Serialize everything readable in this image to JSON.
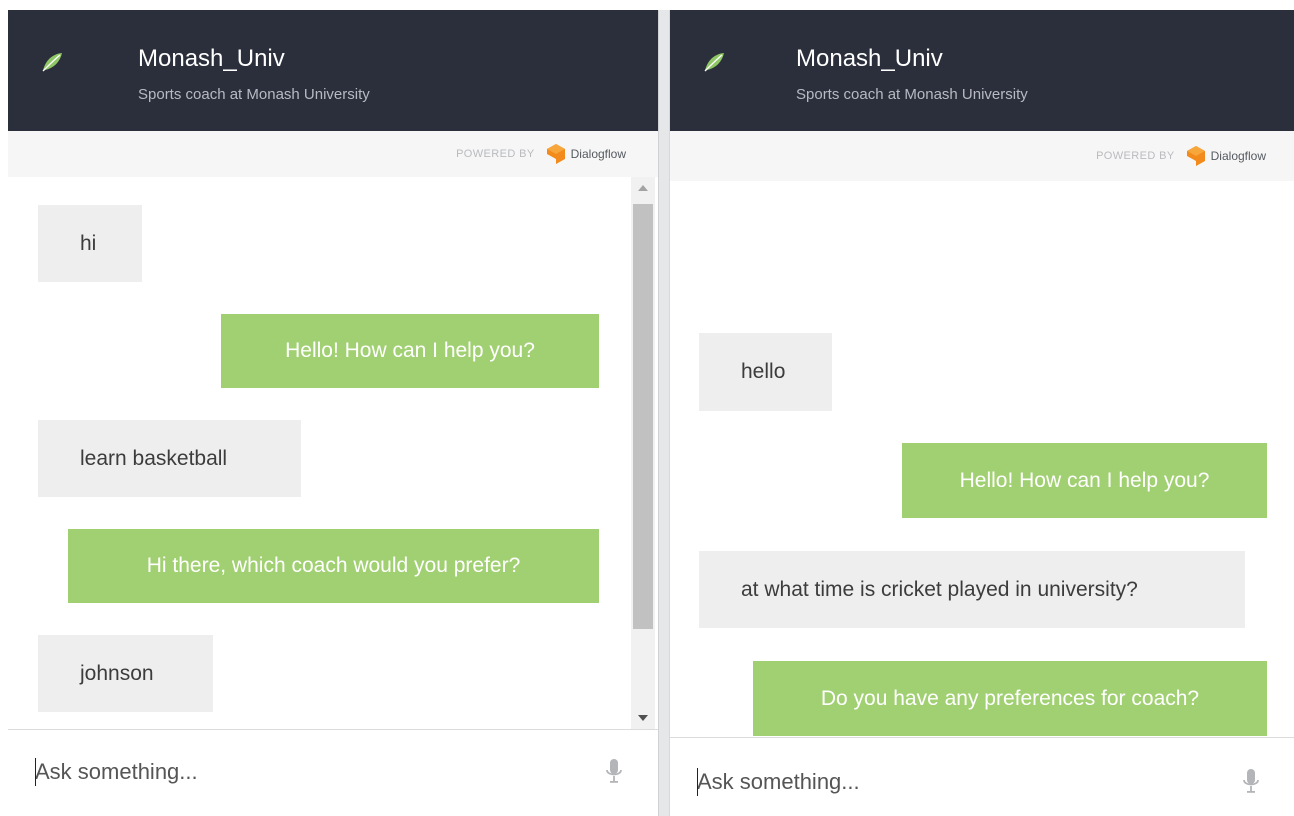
{
  "colors": {
    "header_bg": "#2b2f3b",
    "user_bubble_bg": "#eeeeee",
    "bot_bubble_bg": "#a1d072",
    "dialogflow_orange": "#f28b1c"
  },
  "panels": [
    {
      "agent_name": "Monash_Univ",
      "agent_description": "Sports coach at Monash University",
      "powered_by_label": "POWERED BY",
      "powered_by_brand": "Dialogflow",
      "messages": [
        {
          "from": "user",
          "text": "hi"
        },
        {
          "from": "bot",
          "text": "Hello! How can I help you?"
        },
        {
          "from": "user",
          "text": "learn basketball"
        },
        {
          "from": "bot",
          "text": "Hi there, which coach would you prefer?"
        },
        {
          "from": "user",
          "text": "johnson"
        }
      ],
      "input_placeholder": "Ask something...",
      "icons": {
        "logo": "leaf-logo-icon",
        "mic": "microphone-icon",
        "brand": "dialogflow-icon"
      }
    },
    {
      "agent_name": "Monash_Univ",
      "agent_description": "Sports coach at Monash University",
      "powered_by_label": "POWERED BY",
      "powered_by_brand": "Dialogflow",
      "messages": [
        {
          "from": "user",
          "text": "hello"
        },
        {
          "from": "bot",
          "text": "Hello! How can I help you?"
        },
        {
          "from": "user",
          "text": "at what time is cricket played in university?"
        },
        {
          "from": "bot",
          "text": "Do you have any preferences for coach?"
        }
      ],
      "input_placeholder": "Ask something...",
      "icons": {
        "logo": "leaf-logo-icon",
        "mic": "microphone-icon",
        "brand": "dialogflow-icon"
      }
    }
  ]
}
